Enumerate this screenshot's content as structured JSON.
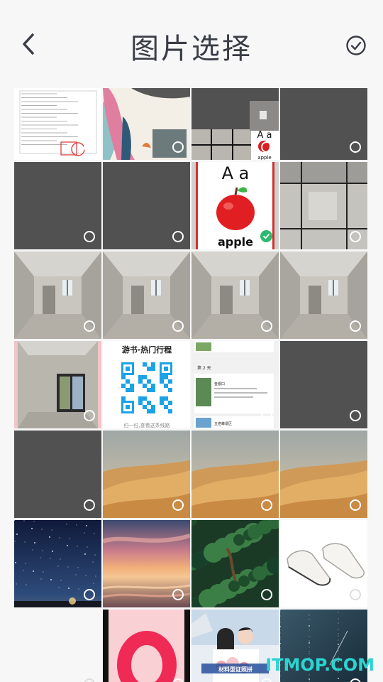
{
  "header": {
    "title": "图片选择",
    "back_icon": "chevron-left-icon",
    "confirm_icon": "check-circle-icon"
  },
  "colors": {
    "placeholder": "#515151",
    "selected_check": "#2dba6e",
    "watermark": "#2bd4d0"
  },
  "photos": [
    {
      "type": "document",
      "selected": false
    },
    {
      "type": "artwork",
      "selected": false
    },
    {
      "type": "room-mixed",
      "selected": false
    },
    {
      "type": "placeholder",
      "selected": false
    },
    {
      "type": "placeholder",
      "selected": false
    },
    {
      "type": "placeholder",
      "selected": false
    },
    {
      "type": "apple-card",
      "selected": true
    },
    {
      "type": "concrete-room",
      "selected": false
    },
    {
      "type": "room",
      "selected": false
    },
    {
      "type": "room",
      "selected": false
    },
    {
      "type": "room",
      "selected": false
    },
    {
      "type": "room",
      "selected": false
    },
    {
      "type": "room-window",
      "selected": false
    },
    {
      "type": "qr-poster",
      "selected": false
    },
    {
      "type": "itinerary",
      "selected": false
    },
    {
      "type": "placeholder",
      "selected": false
    },
    {
      "type": "placeholder",
      "selected": false
    },
    {
      "type": "desert",
      "selected": false
    },
    {
      "type": "desert",
      "selected": false
    },
    {
      "type": "desert",
      "selected": false
    },
    {
      "type": "night-sky",
      "selected": false
    },
    {
      "type": "sunset-sea",
      "selected": false
    },
    {
      "type": "forest",
      "selected": false
    },
    {
      "type": "sneakers",
      "selected": false
    },
    {
      "type": "blank",
      "selected": false
    },
    {
      "type": "pink-ring",
      "selected": false
    },
    {
      "type": "couple-photo",
      "selected": false
    },
    {
      "type": "starry-night",
      "selected": false
    }
  ],
  "apple_card": {
    "letters": "A a",
    "word": "apple"
  },
  "small_apple_card": {
    "letters": "A a",
    "word": "apple"
  },
  "qr_poster": {
    "title": "游书·热门行程",
    "footer": "扫一扫,查看这条线路"
  },
  "itinerary": {
    "day": "第 2 天",
    "place1": "金银口",
    "place2": "五老峰景区"
  },
  "couple_photo": {
    "caption": "材料型证照拼"
  },
  "watermark": "ITMOP.COM"
}
